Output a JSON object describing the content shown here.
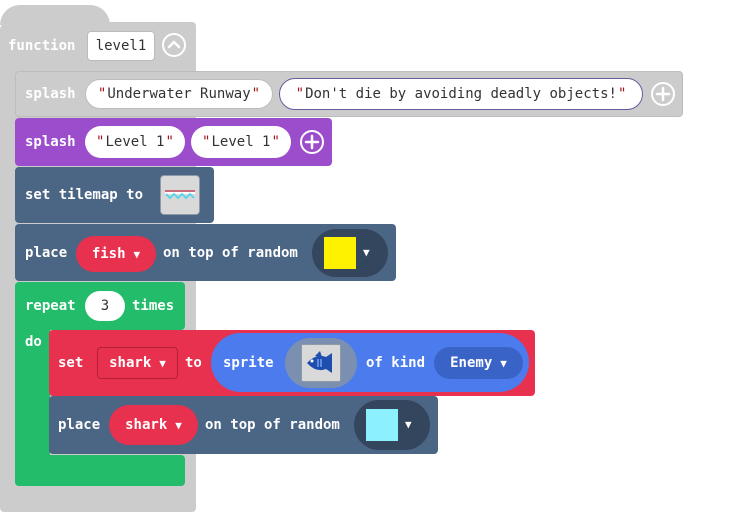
{
  "function_block": {
    "keyword": "function",
    "name": "level1",
    "collapse_icon": "chevron-up-circle-icon",
    "colors": {
      "fill": "#cccccc",
      "text": "#ffffff"
    }
  },
  "splash_disabled": {
    "keyword": "splash",
    "title": "Underwater Runway",
    "subtitle": "Don't die by avoiding deadly objects!",
    "add_icon": "plus-circle-icon"
  },
  "splash_active": {
    "keyword": "splash",
    "title": "Level 1",
    "subtitle": "Level 1",
    "add_icon": "plus-circle-icon",
    "color": "#9c4dcc"
  },
  "tilemap_block": {
    "prefix": "set tilemap to",
    "tile_icon": "tilemap-thumbnail-icon",
    "color": "#4b6584"
  },
  "place_fish": {
    "keyword": "place",
    "variable": "fish",
    "middle": "on top of random",
    "tile_color": "#fff200",
    "color": "#4b6584",
    "var_color": "#e8314f"
  },
  "repeat_block": {
    "keyword": "repeat",
    "count": "3",
    "suffix": "times",
    "do_label": "do",
    "color": "#23bc6a"
  },
  "set_shark": {
    "keyword": "set",
    "variable": "shark",
    "to_label": "to",
    "sprite_keyword": "sprite",
    "sprite_icon": "fish-sprite-icon",
    "kind_label": "of kind",
    "kind_value": "Enemy",
    "color": "#e8314f",
    "sprite_color": "#4b7bec"
  },
  "place_shark": {
    "keyword": "place",
    "variable": "shark",
    "middle": "on top of random",
    "tile_color": "#8cf0ff",
    "color": "#4b6584"
  }
}
